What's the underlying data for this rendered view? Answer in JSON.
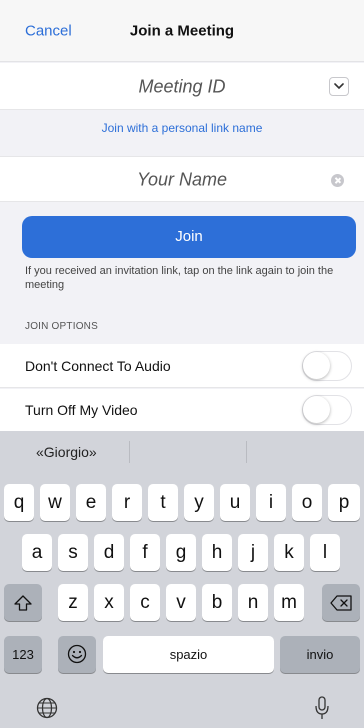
{
  "header": {
    "cancel_label": "Cancel",
    "title": "Join a Meeting"
  },
  "meeting_id": {
    "placeholder": "Meeting ID",
    "dropdown_icon": "chevron-down-icon"
  },
  "personal_link_label": "Join with a personal link name",
  "your_name": {
    "placeholder": "Your Name",
    "clear_icon": "clear-circle-icon"
  },
  "join_button_label": "Join",
  "info_text": "If you received an invitation link, tap on the link again to join the meeting",
  "join_options": {
    "header": "JOIN OPTIONS",
    "items": [
      {
        "label": "Don't Connect To Audio",
        "on": false
      },
      {
        "label": "Turn Off My Video",
        "on": false
      }
    ]
  },
  "keyboard": {
    "suggestion": "«Giorgio»",
    "row1": [
      "q",
      "w",
      "e",
      "r",
      "t",
      "y",
      "u",
      "i",
      "o",
      "p"
    ],
    "row2": [
      "a",
      "s",
      "d",
      "f",
      "g",
      "h",
      "j",
      "k",
      "l"
    ],
    "row3": [
      "z",
      "x",
      "c",
      "v",
      "b",
      "n",
      "m"
    ],
    "numbers_label": "123",
    "space_label": "spazio",
    "return_label": "invio",
    "icons": {
      "shift": "shift-icon",
      "delete": "backspace-icon",
      "emoji": "emoji-icon",
      "globe": "globe-icon",
      "mic": "microphone-icon"
    }
  },
  "colors": {
    "accent": "#2d6fd8",
    "background": "#f2f2f6",
    "keyboard": "#d2d4da"
  }
}
